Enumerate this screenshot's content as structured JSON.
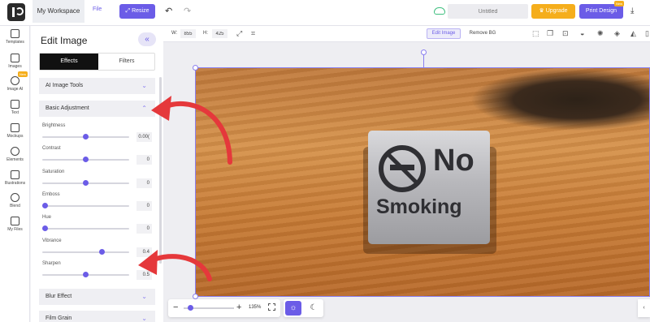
{
  "topbar": {
    "workspace": "My Workspace",
    "file": "File",
    "resize": "Resize",
    "title_placeholder": "Untitled",
    "upgrade": "Upgrade",
    "print_design": "Print Design",
    "print_badge": "New",
    "icons": [
      "logo-icon",
      "undo-icon",
      "redo-icon",
      "cloud-sync-icon",
      "download-icon"
    ]
  },
  "rail": {
    "items": [
      {
        "label": "Templates",
        "icon": "templates-icon"
      },
      {
        "label": "Images",
        "icon": "image-icon"
      },
      {
        "label": "Image AI",
        "icon": "image-ai-icon",
        "badge": "New"
      },
      {
        "label": "Text",
        "icon": "text-icon"
      },
      {
        "label": "Mockups",
        "icon": "mockups-icon"
      },
      {
        "label": "Elements",
        "icon": "elements-icon"
      },
      {
        "label": "Illustrations",
        "icon": "illustrations-icon"
      },
      {
        "label": "Blend",
        "icon": "blend-icon"
      },
      {
        "label": "My Files",
        "icon": "folder-icon"
      }
    ]
  },
  "panel": {
    "title": "Edit Image",
    "tabs": [
      "Effects",
      "Filters"
    ],
    "active_tab": "Effects",
    "sections": {
      "ai_tools": "AI Image Tools",
      "basic": "Basic Adjustment",
      "blur": "Blur Effect",
      "grain": "Film Grain"
    },
    "adjustments": [
      {
        "label": "Brightness",
        "value": "0.00(",
        "level": 0.5
      },
      {
        "label": "Contrast",
        "value": "0",
        "level": 0.5
      },
      {
        "label": "Saturation",
        "value": "0",
        "level": 0.5
      },
      {
        "label": "Emboss",
        "value": "0",
        "level": 0.0
      },
      {
        "label": "Hue",
        "value": "0",
        "level": 0.0
      },
      {
        "label": "Vibrance",
        "value": "0.4",
        "level": 0.7
      },
      {
        "label": "Sharpen",
        "value": "0.5",
        "level": 0.5
      }
    ]
  },
  "toolbar": {
    "w_label": "W:",
    "w_value": "855",
    "h_label": "H:",
    "h_value": "425",
    "edit_image": "Edit Image",
    "remove_bg": "Remove BG"
  },
  "canvas": {
    "sign_line1": "No",
    "sign_line2": "Smoking"
  },
  "zoom": {
    "value": "135%",
    "level": 0.08
  },
  "colors": {
    "accent": "#6b5ce7",
    "upgrade": "#f5ae1c",
    "arrow": "#e5383b"
  }
}
